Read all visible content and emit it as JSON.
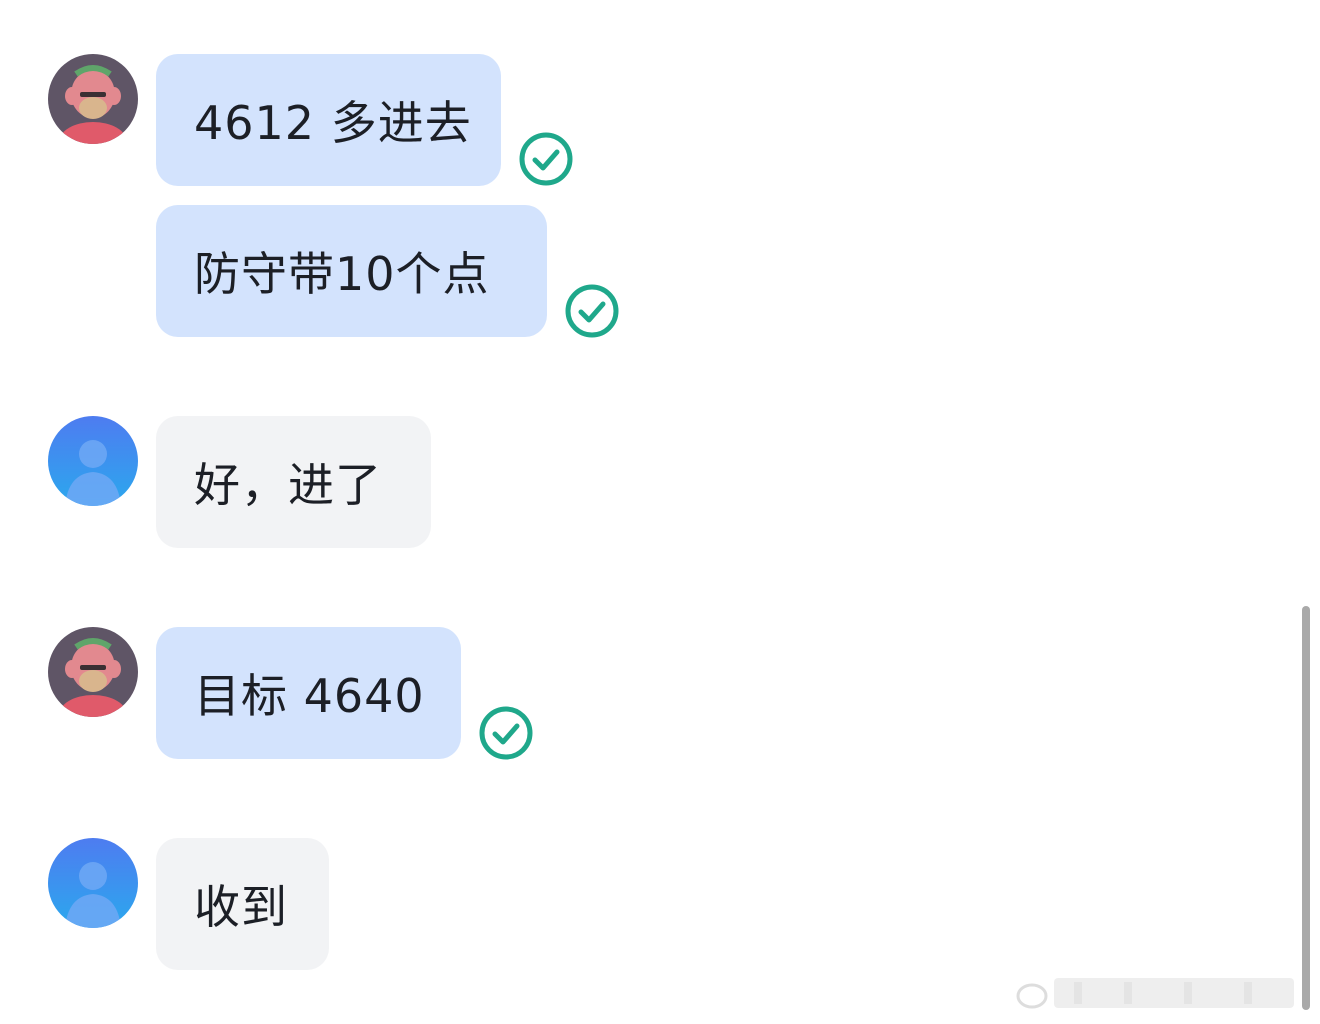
{
  "messages": [
    {
      "side": "mine",
      "text": "4612 多进去",
      "status": "read-check-icon"
    },
    {
      "side": "mine",
      "text": "防守带10个点",
      "status": "read-check-icon"
    },
    {
      "side": "other",
      "text": "好，进了"
    },
    {
      "side": "mine",
      "text": "目标 4640",
      "status": "read-check-icon"
    },
    {
      "side": "other",
      "text": "收到"
    }
  ],
  "colors": {
    "mine_bubble": "#d3e3fd",
    "other_bubble": "#f2f3f5",
    "read_check": "#1fa88b",
    "text": "#1c1f26"
  }
}
